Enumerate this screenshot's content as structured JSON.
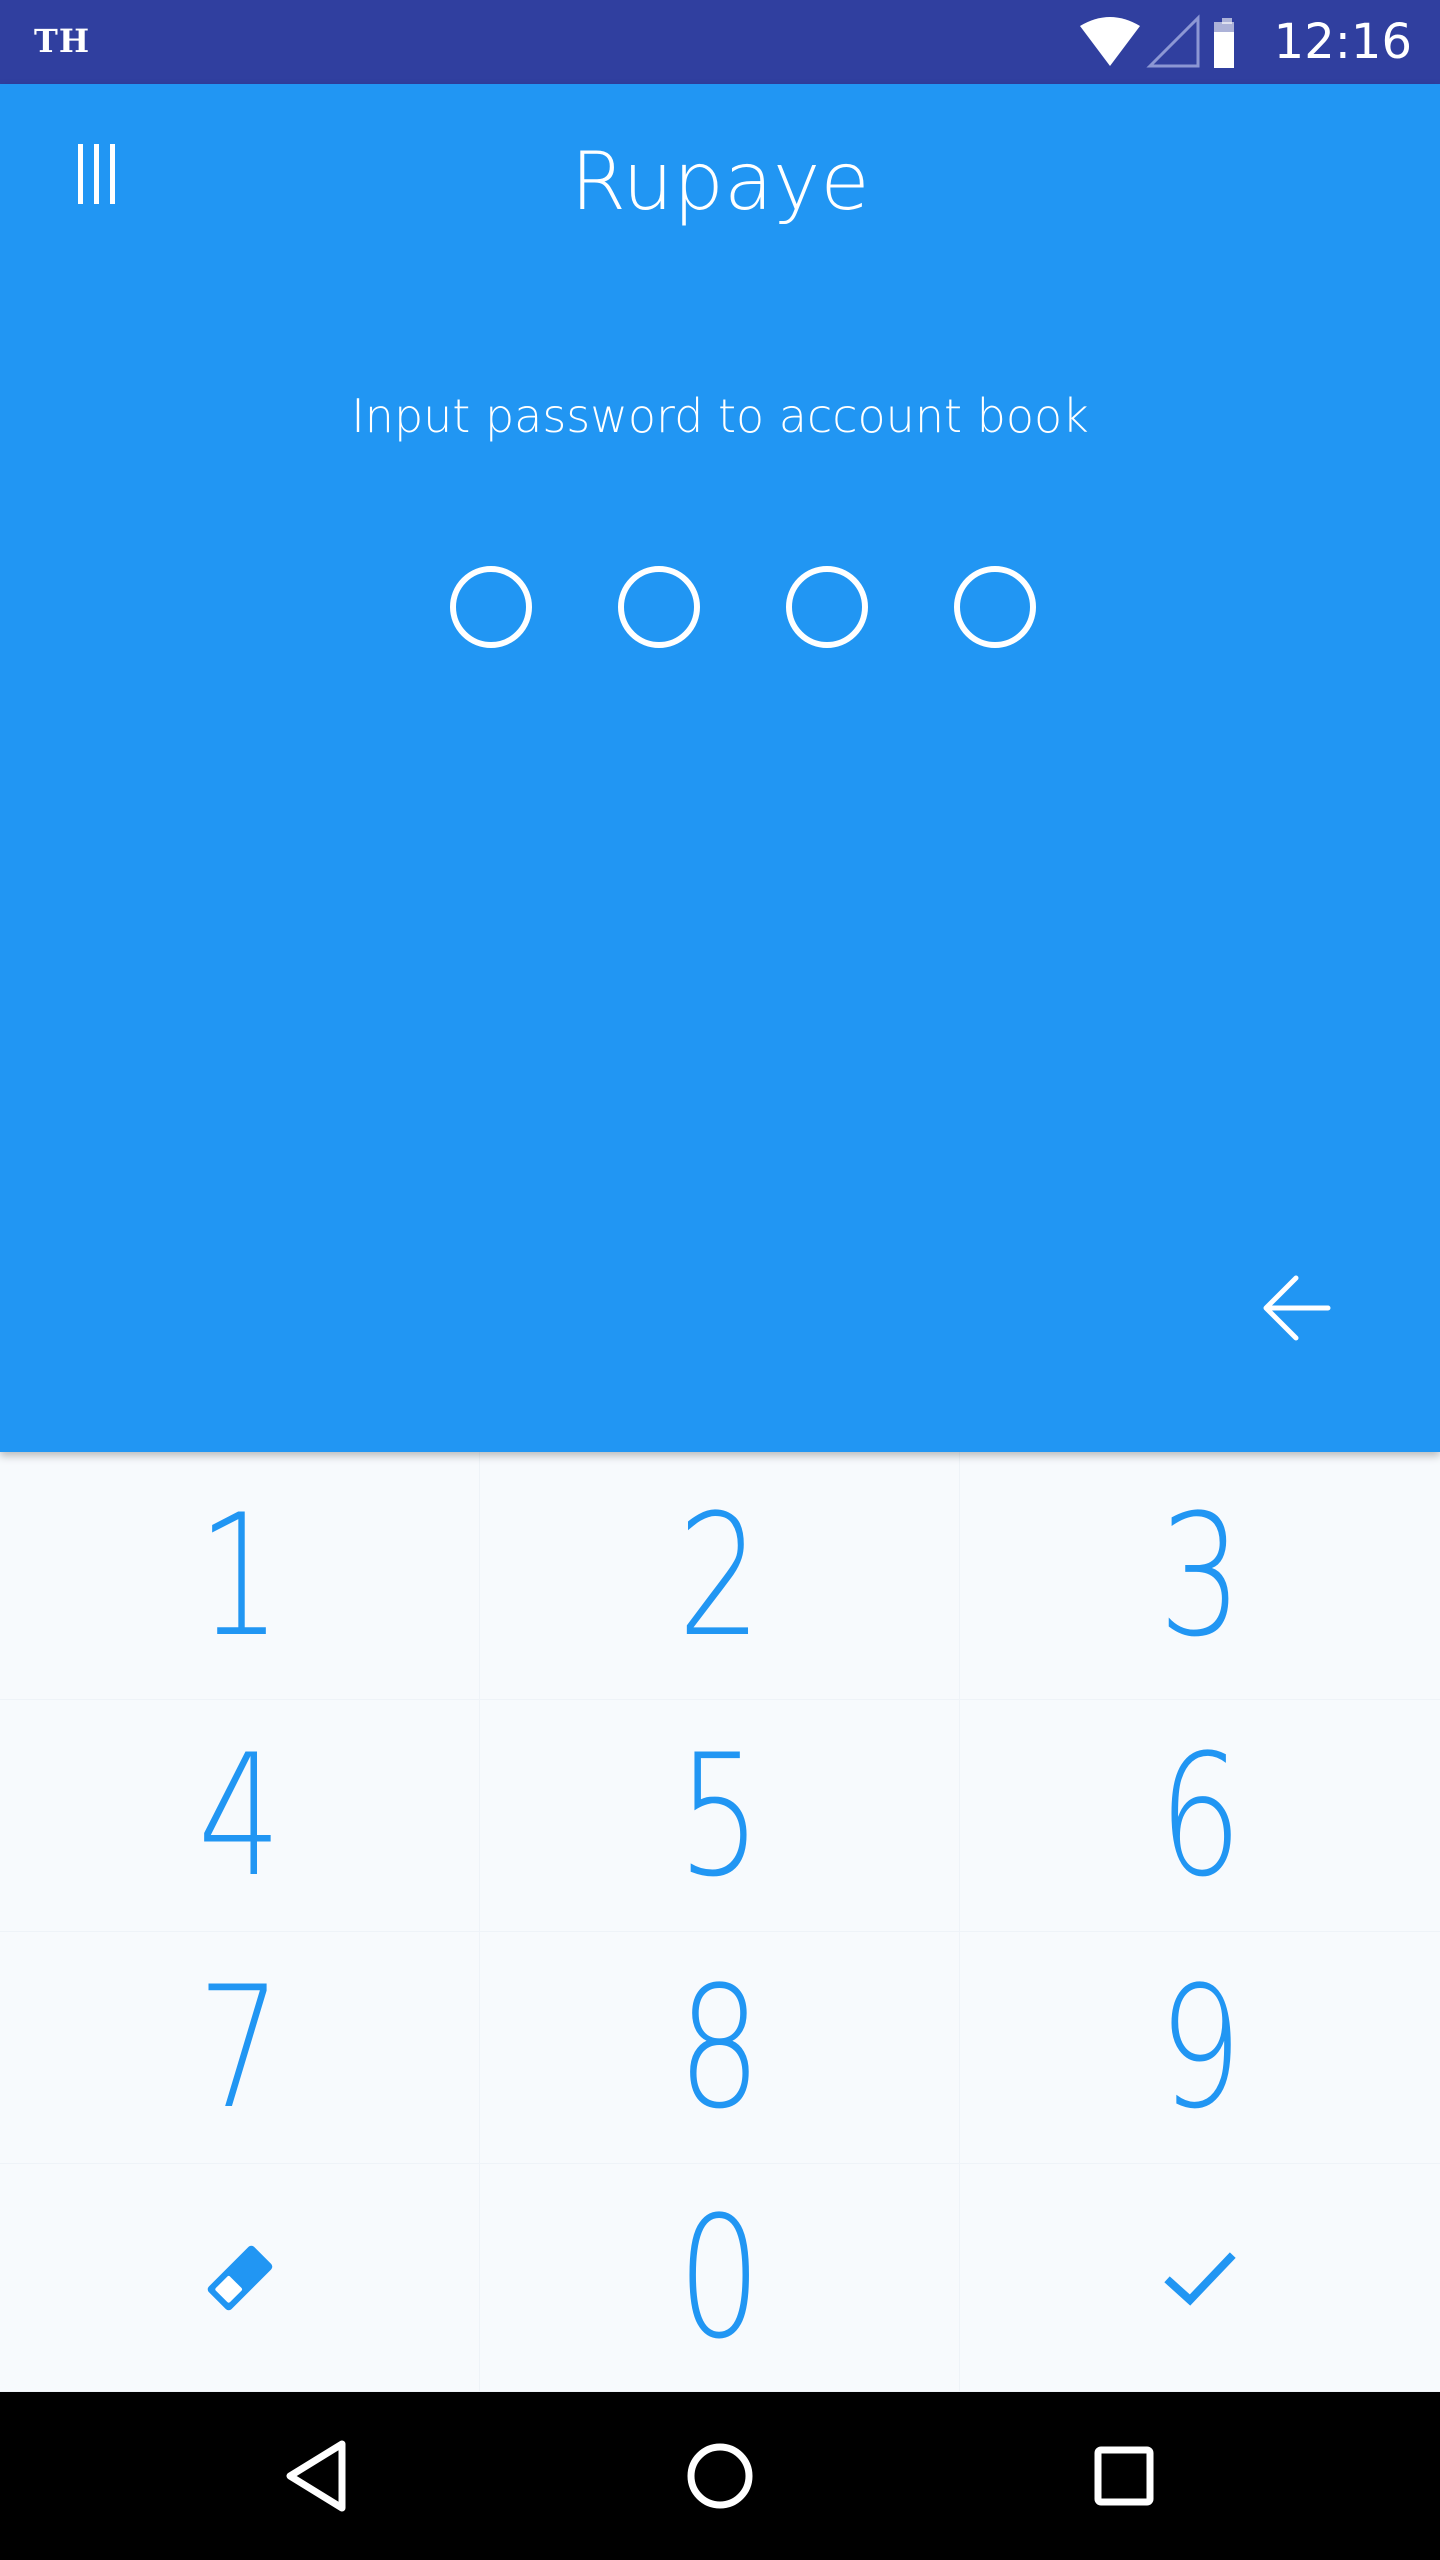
{
  "status_bar": {
    "carrier": "TH",
    "time": "12:16",
    "icons": [
      "wifi-icon",
      "cell-signal-icon",
      "battery-icon"
    ]
  },
  "header": {
    "title": "Rupaye",
    "menu_icon": "menu-icon"
  },
  "lock": {
    "prompt": "Input password to account book",
    "pin_length": 4,
    "entered": 0,
    "backspace_icon": "arrow-left-icon"
  },
  "keypad": {
    "keys": [
      "1",
      "2",
      "3",
      "4",
      "5",
      "6",
      "7",
      "8",
      "9"
    ],
    "zero": "0",
    "clear_icon": "eraser-icon",
    "confirm_icon": "check-icon"
  },
  "nav_bar": {
    "icons": [
      "back-triangle-icon",
      "home-circle-icon",
      "recents-square-icon"
    ]
  },
  "colors": {
    "status_bar": "#303F9F",
    "primary": "#2196F3",
    "keypad_bg": "#F7FAFD",
    "white": "#FFFFFF"
  }
}
